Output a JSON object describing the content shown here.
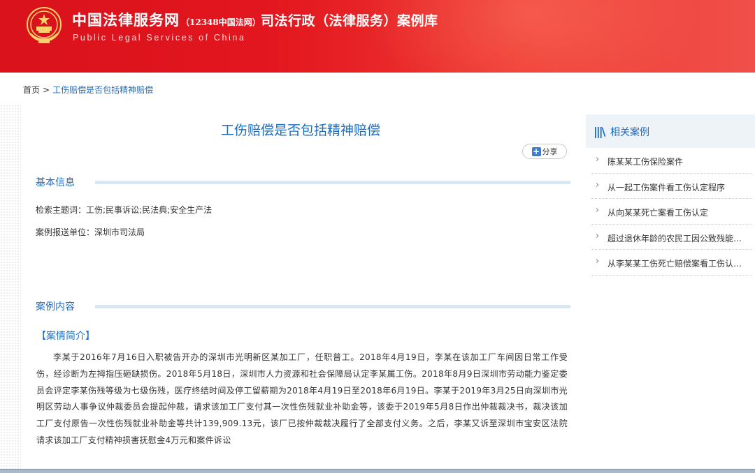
{
  "header": {
    "brand_cn": "中国法律服务网",
    "brand_cn_sub": "（12348中国法网）",
    "brand_en": "Public Legal Services of China",
    "site_title": "司法行政（法律服务）案例库",
    "emblem_icon": "national-emblem-icon",
    "colors": {
      "header_red": "#d9121b",
      "accent_blue": "#1a6dc4"
    }
  },
  "breadcrumb": {
    "home": "首页",
    "separator": ">",
    "current": "工伤赔偿是否包括精神赔偿"
  },
  "article": {
    "title": "工伤赔偿是否包括精神赔偿",
    "share_label": "分享",
    "share_icon": "plus-icon"
  },
  "basic_info": {
    "heading": "基本信息",
    "keywords": "检索主题词：工伤;民事诉讼;民法典;安全生产法",
    "submitter": "案例报送单位：深圳市司法局"
  },
  "case_content": {
    "heading": "案例内容",
    "subheading": "【案情简介】",
    "body": "李某于2016年7月16日入职被告开办的深圳市光明新区某加工厂，任职普工。2018年4月19日，李某在该加工厂车间因日常工作受伤，经诊断为左拇指压砸缺损伤。2018年5月18日，深圳市人力资源和社会保障局认定李某属工伤。2018年8月9日深圳市劳动能力鉴定委员会评定李某伤残等级为七级伤残，医疗终结时间及停工留薪期为2018年4月19日至2018年6月19日。李某于2019年3月25日向深圳市光明区劳动人事争议仲裁委员会提起仲裁，请求该加工厂支付其一次性伤残就业补助金等，该委于2019年5月8日作出仲裁裁决书，裁决该加工厂支付原告一次性伤残就业补助金等共计139,909.13元，该厂已按仲裁裁决履行了全部支付义务。之后，李某又诉至深圳市宝安区法院请求该加工厂支付精神损害抚慰金4万元和案件诉讼"
  },
  "sidebar": {
    "heading": "相关案例",
    "heading_icon": "bars-icon",
    "items": [
      {
        "label": "陈某某工伤保险案件"
      },
      {
        "label": "从一起工伤案件看工伤认定程序"
      },
      {
        "label": "从向某某死亡案看工伤认定"
      },
      {
        "label": "超过退休年龄的农民工因公致残能否认定工伤"
      },
      {
        "label": "从李某某工伤死亡赔偿案看工伤认定标准"
      }
    ]
  }
}
